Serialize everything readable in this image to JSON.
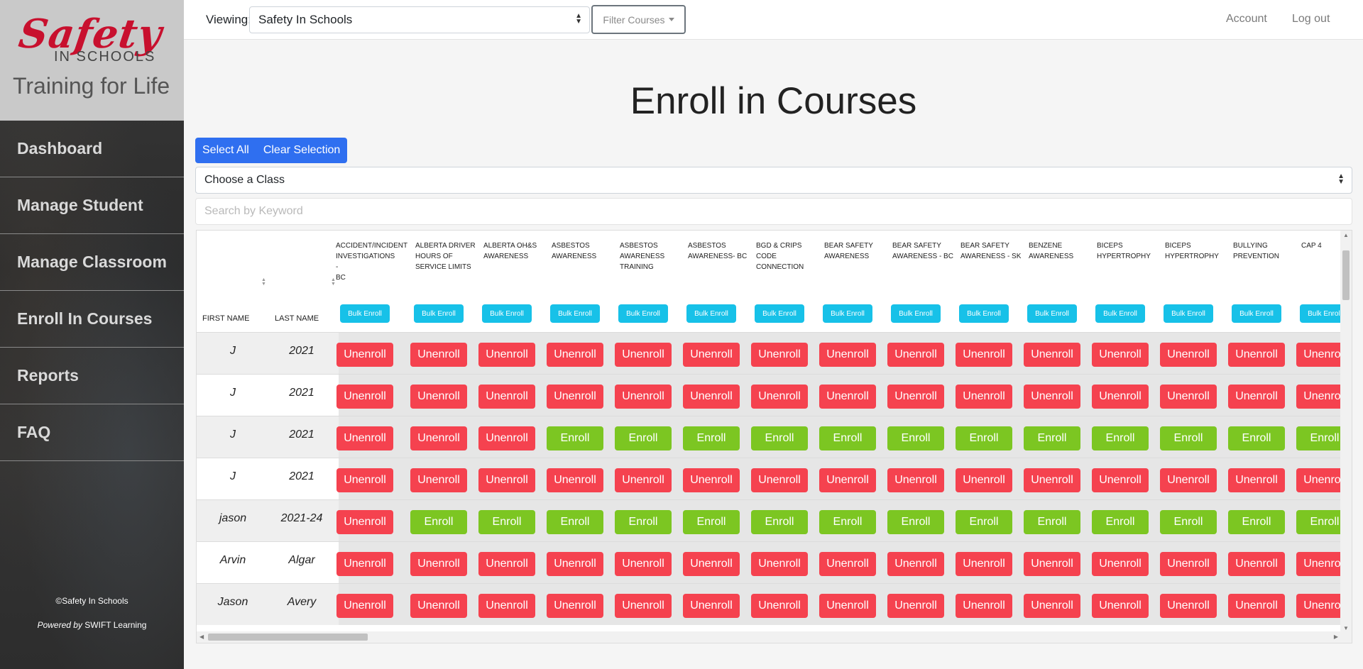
{
  "brand": {
    "logo_text": "Safety",
    "logo_sub": "IN SCHOOLS",
    "tagline": "Training for Life"
  },
  "sidebar": {
    "items": [
      {
        "label": "Dashboard"
      },
      {
        "label": "Manage Student"
      },
      {
        "label": "Manage Classroom"
      },
      {
        "label": "Enroll In Courses"
      },
      {
        "label": "Reports"
      },
      {
        "label": "FAQ"
      }
    ],
    "copyright": "©Safety In Schools",
    "powered_by_prefix": "Powered by",
    "powered_by_name": "SWIFT Learning"
  },
  "topbar": {
    "viewing_label": "Viewing:",
    "school_value": "Safety In Schools",
    "filter_label": "Filter Courses",
    "account_label": "Account",
    "logout_label": "Log out"
  },
  "main": {
    "title": "Enroll in Courses",
    "select_all_label": "Select All",
    "clear_selection_label": "Clear Selection",
    "class_select_value": "Choose a Class",
    "search_placeholder": "Search by Keyword"
  },
  "table": {
    "first_name_header": "FIRST NAME",
    "last_name_header": "LAST NAME",
    "bulk_label": "Bulk Enroll",
    "courses": [
      [
        "ACCIDENT/INCIDENT",
        "INVESTIGATIONS -",
        "BC"
      ],
      [
        "ALBERTA DRIVER",
        "HOURS OF",
        "SERVICE LIMITS"
      ],
      [
        "ALBERTA OH&S",
        "AWARENESS"
      ],
      [
        "ASBESTOS",
        "AWARENESS"
      ],
      [
        "ASBESTOS",
        "AWARENESS",
        "TRAINING"
      ],
      [
        "ASBESTOS",
        "AWARENESS- BC"
      ],
      [
        "BGD & CRIPS",
        "CODE",
        "CONNECTION"
      ],
      [
        "BEAR SAFETY",
        "AWARENESS"
      ],
      [
        "BEAR SAFETY",
        "AWARENESS - BC"
      ],
      [
        "BEAR SAFETY",
        "AWARENESS - SK"
      ],
      [
        "BENZENE",
        "AWARENESS"
      ],
      [
        "BICEPS",
        "HYPERTROPHY"
      ],
      [
        "BICEPS",
        "HYPERTROPHY"
      ],
      [
        "BULLYING",
        "PREVENTION"
      ],
      [
        "CAP 4"
      ]
    ],
    "unenroll_label": "Unenroll",
    "enroll_label": "Enroll",
    "rows": [
      {
        "first": "J",
        "last": "2021",
        "status": [
          "U",
          "U",
          "U",
          "U",
          "U",
          "U",
          "U",
          "U",
          "U",
          "U",
          "U",
          "U",
          "U",
          "U",
          "U"
        ]
      },
      {
        "first": "J",
        "last": "2021",
        "status": [
          "U",
          "U",
          "U",
          "U",
          "U",
          "U",
          "U",
          "U",
          "U",
          "U",
          "U",
          "U",
          "U",
          "U",
          "U"
        ]
      },
      {
        "first": "J",
        "last": "2021",
        "status": [
          "U",
          "U",
          "U",
          "E",
          "E",
          "E",
          "E",
          "E",
          "E",
          "E",
          "E",
          "E",
          "E",
          "E",
          "E"
        ]
      },
      {
        "first": "J",
        "last": "2021",
        "status": [
          "U",
          "U",
          "U",
          "U",
          "U",
          "U",
          "U",
          "U",
          "U",
          "U",
          "U",
          "U",
          "U",
          "U",
          "U"
        ]
      },
      {
        "first": "jason",
        "last": "2021-24",
        "status": [
          "U",
          "E",
          "E",
          "E",
          "E",
          "E",
          "E",
          "E",
          "E",
          "E",
          "E",
          "E",
          "E",
          "E",
          "E"
        ]
      },
      {
        "first": "Arvin",
        "last": "Algar",
        "status": [
          "U",
          "U",
          "U",
          "U",
          "U",
          "U",
          "U",
          "U",
          "U",
          "U",
          "U",
          "U",
          "U",
          "U",
          "U"
        ]
      },
      {
        "first": "Jason",
        "last": "Avery",
        "status": [
          "U",
          "U",
          "U",
          "U",
          "U",
          "U",
          "U",
          "U",
          "U",
          "U",
          "U",
          "U",
          "U",
          "U",
          "U"
        ]
      }
    ]
  },
  "colors": {
    "primary": "#2f6ff0",
    "bulk": "#17c1e8",
    "unenroll": "#f5424f",
    "enroll": "#7cc622"
  }
}
